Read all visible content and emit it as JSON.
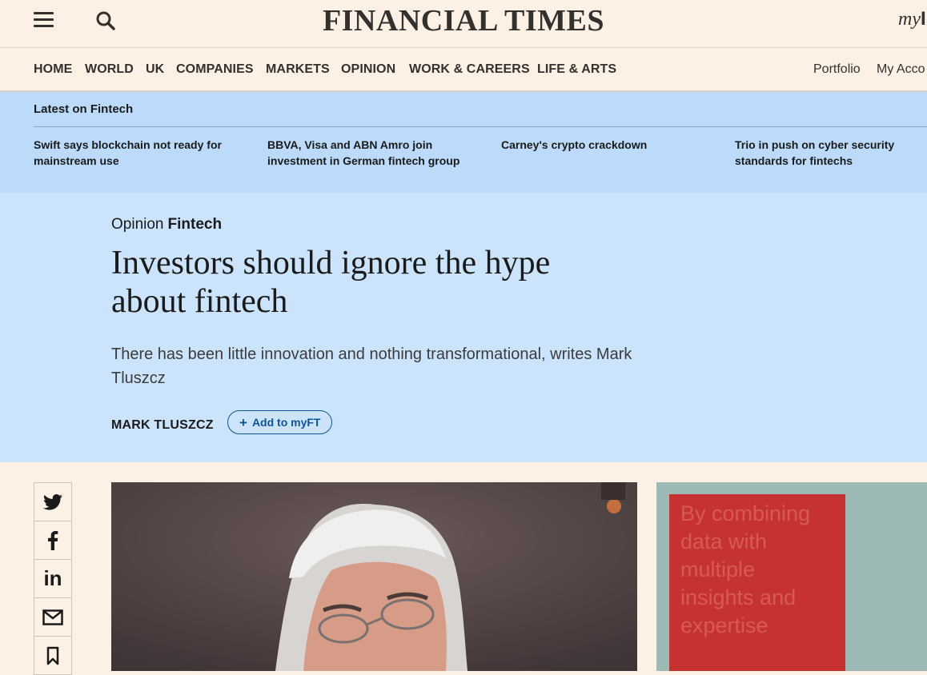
{
  "header": {
    "logo": "FINANCIAL TIMES",
    "myft_label": "my",
    "menu_icon": "hamburger-menu-icon",
    "search_icon": "search-icon"
  },
  "nav": {
    "items": [
      "HOME",
      "WORLD",
      "UK",
      "COMPANIES",
      "MARKETS",
      "OPINION",
      "WORK & CAREERS",
      "LIFE & ARTS"
    ],
    "right": [
      "Portfolio",
      "My Acco"
    ]
  },
  "latest": {
    "title": "Latest on Fintech",
    "links": [
      "Swift says blockchain not ready for mainstream use",
      "BBVA, Visa and ABN Amro join investment in German fintech group",
      "Carney's crypto crackdown",
      "Trio in push on cyber security standards for fintechs"
    ]
  },
  "article": {
    "genre": "Opinion",
    "topic": "Fintech",
    "headline": "Investors should ignore the hype about fintech",
    "standfirst": "There has been little innovation and nothing transformational, writes Mark Tluszcz",
    "byline": "MARK TLUSZCZ",
    "add_to_myft": "Add to myFT",
    "add_icon": "plus-icon"
  },
  "share": {
    "icons": [
      "twitter-icon",
      "facebook-icon",
      "linkedin-icon",
      "email-icon",
      "bookmark-icon"
    ]
  },
  "ad": {
    "text": "By combining data with multiple insights and expertise"
  },
  "colors": {
    "page_bg": "#fdf1e5",
    "latest_bg": "#bcdbfa",
    "hero_bg": "#cce4fb",
    "accent": "#0f5499",
    "ad_red": "#c63232",
    "ad_teal": "#9cb9b6"
  }
}
